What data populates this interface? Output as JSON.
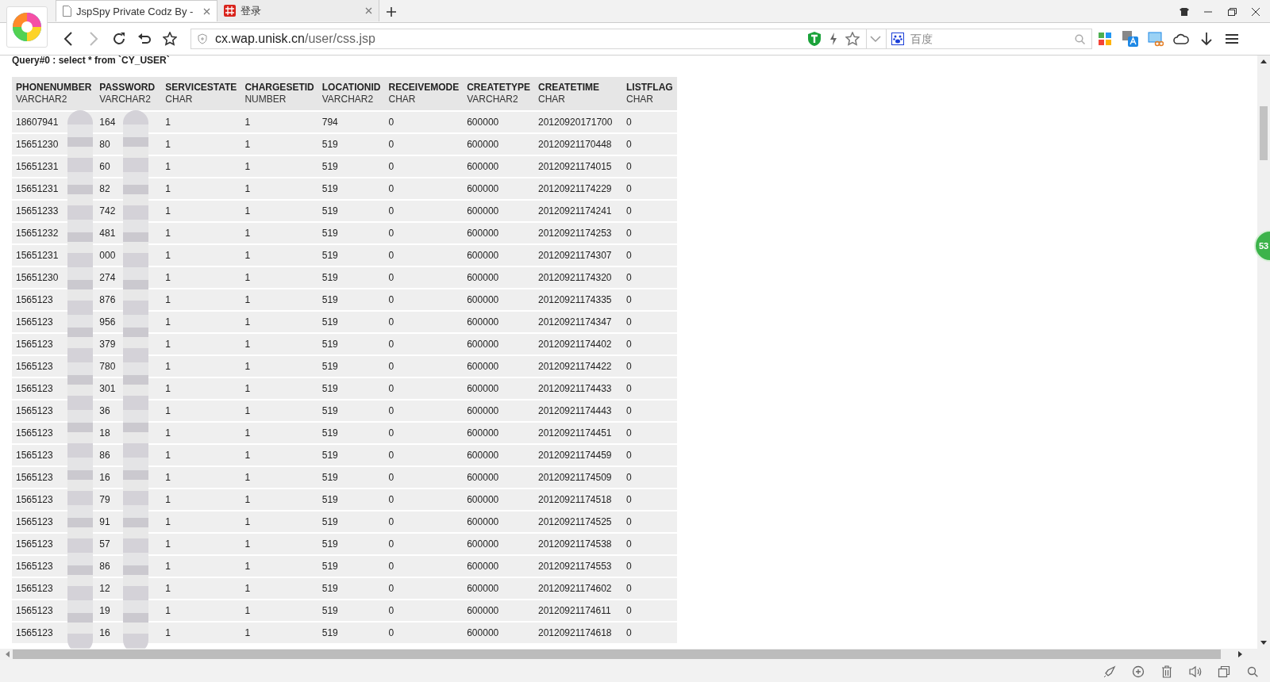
{
  "browser": {
    "tabs": [
      {
        "title": "JspSpy Private Codz By -",
        "kind": "page",
        "selected": true
      },
      {
        "title": "登录",
        "kind": "site",
        "selected": false
      }
    ],
    "address": {
      "host": "cx.wap.unisk.cn",
      "path": "/user/css.jsp"
    },
    "search": {
      "placeholder": "百度"
    }
  },
  "page": {
    "query": "Query#0 : select * from `CY_USER`",
    "table": {
      "columns": [
        {
          "name": "PHONENUMBER",
          "type": "VARCHAR2"
        },
        {
          "name": "PASSWORD",
          "type": "VARCHAR2"
        },
        {
          "name": "SERVICESTATE",
          "type": "CHAR"
        },
        {
          "name": "CHARGESETID",
          "type": "NUMBER"
        },
        {
          "name": "LOCATIONID",
          "type": "VARCHAR2"
        },
        {
          "name": "RECEIVEMODE",
          "type": "CHAR"
        },
        {
          "name": "CREATETYPE",
          "type": "VARCHAR2"
        },
        {
          "name": "CREATETIME",
          "type": "CHAR"
        },
        {
          "name": "LISTFLAG",
          "type": "CHAR"
        }
      ],
      "rows": [
        [
          "18607941",
          "164",
          "1",
          "1",
          "794",
          "0",
          "600000",
          "20120920171700",
          "0"
        ],
        [
          "15651230",
          "80",
          "1",
          "1",
          "519",
          "0",
          "600000",
          "20120921170448",
          "0"
        ],
        [
          "15651231",
          "60",
          "1",
          "1",
          "519",
          "0",
          "600000",
          "20120921174015",
          "0"
        ],
        [
          "15651231",
          "82",
          "1",
          "1",
          "519",
          "0",
          "600000",
          "20120921174229",
          "0"
        ],
        [
          "15651233",
          "742",
          "1",
          "1",
          "519",
          "0",
          "600000",
          "20120921174241",
          "0"
        ],
        [
          "15651232",
          "481",
          "1",
          "1",
          "519",
          "0",
          "600000",
          "20120921174253",
          "0"
        ],
        [
          "15651231",
          "000",
          "1",
          "1",
          "519",
          "0",
          "600000",
          "20120921174307",
          "0"
        ],
        [
          "15651230",
          "274",
          "1",
          "1",
          "519",
          "0",
          "600000",
          "20120921174320",
          "0"
        ],
        [
          "1565123",
          "876",
          "1",
          "1",
          "519",
          "0",
          "600000",
          "20120921174335",
          "0"
        ],
        [
          "1565123",
          "956",
          "1",
          "1",
          "519",
          "0",
          "600000",
          "20120921174347",
          "0"
        ],
        [
          "1565123",
          "379",
          "1",
          "1",
          "519",
          "0",
          "600000",
          "20120921174402",
          "0"
        ],
        [
          "1565123",
          "780",
          "1",
          "1",
          "519",
          "0",
          "600000",
          "20120921174422",
          "0"
        ],
        [
          "1565123",
          "301",
          "1",
          "1",
          "519",
          "0",
          "600000",
          "20120921174433",
          "0"
        ],
        [
          "1565123",
          "36",
          "1",
          "1",
          "519",
          "0",
          "600000",
          "20120921174443",
          "0"
        ],
        [
          "1565123",
          "18",
          "1",
          "1",
          "519",
          "0",
          "600000",
          "20120921174451",
          "0"
        ],
        [
          "1565123",
          "86",
          "1",
          "1",
          "519",
          "0",
          "600000",
          "20120921174459",
          "0"
        ],
        [
          "1565123",
          "16",
          "1",
          "1",
          "519",
          "0",
          "600000",
          "20120921174509",
          "0"
        ],
        [
          "1565123",
          "79",
          "1",
          "1",
          "519",
          "0",
          "600000",
          "20120921174518",
          "0"
        ],
        [
          "1565123",
          "91",
          "1",
          "1",
          "519",
          "0",
          "600000",
          "20120921174525",
          "0"
        ],
        [
          "1565123",
          "57",
          "1",
          "1",
          "519",
          "0",
          "600000",
          "20120921174538",
          "0"
        ],
        [
          "1565123",
          "86",
          "1",
          "1",
          "519",
          "0",
          "600000",
          "20120921174553",
          "0"
        ],
        [
          "1565123",
          "12",
          "1",
          "1",
          "519",
          "0",
          "600000",
          "20120921174602",
          "0"
        ],
        [
          "1565123",
          "19",
          "1",
          "1",
          "519",
          "0",
          "600000",
          "20120921174611",
          "0"
        ],
        [
          "1565123",
          "16",
          "1",
          "1",
          "519",
          "0",
          "600000",
          "20120921174618",
          "0"
        ]
      ]
    }
  },
  "side_badge": "53"
}
